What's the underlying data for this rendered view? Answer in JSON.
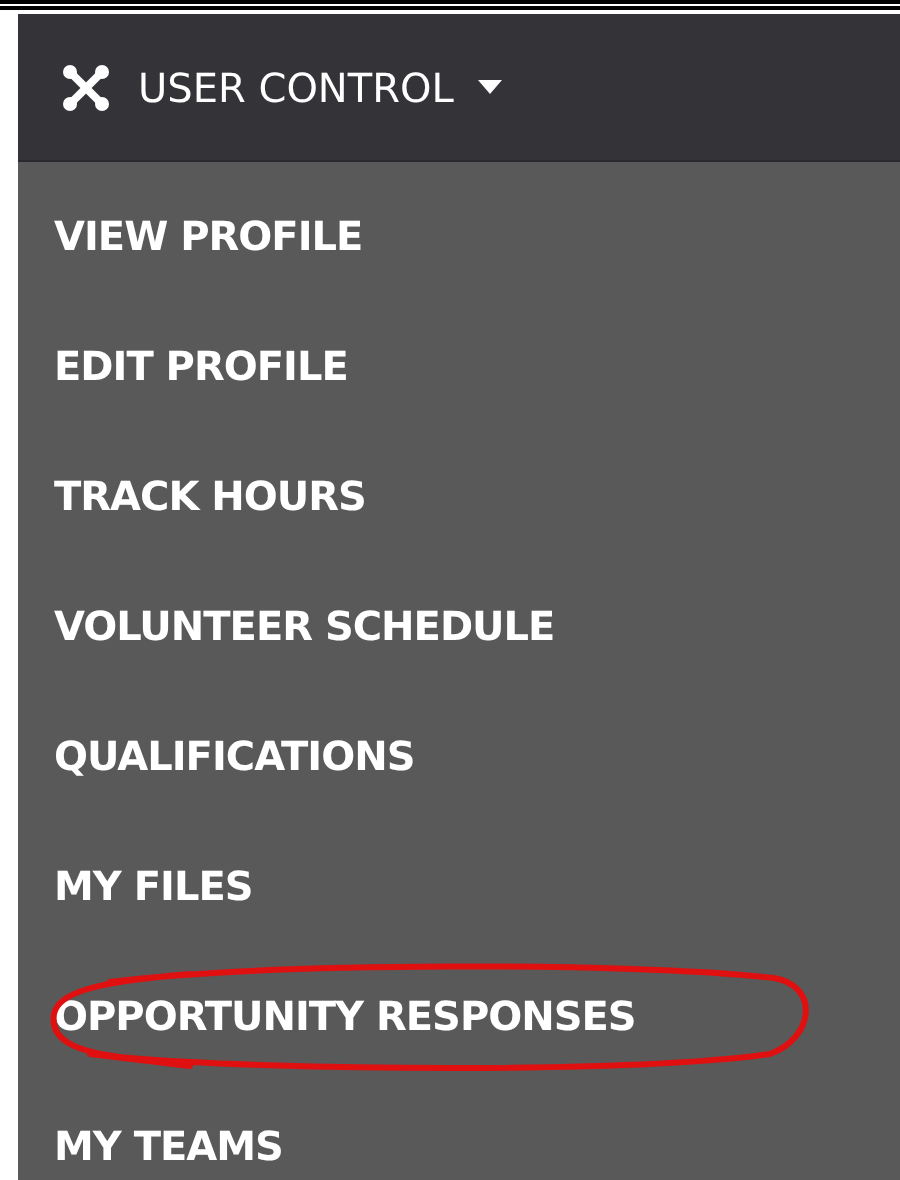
{
  "menu": {
    "title": "USER CONTROL",
    "expanded": true
  },
  "items": [
    {
      "label": "VIEW PROFILE",
      "circled": false
    },
    {
      "label": "EDIT PROFILE",
      "circled": false
    },
    {
      "label": "TRACK HOURS",
      "circled": false
    },
    {
      "label": "VOLUNTEER SCHEDULE",
      "circled": false
    },
    {
      "label": "QUALIFICATIONS",
      "circled": false
    },
    {
      "label": "MY FILES",
      "circled": false
    },
    {
      "label": "OPPORTUNITY RESPONSES",
      "circled": true
    },
    {
      "label": "MY TEAMS",
      "circled": false
    }
  ]
}
